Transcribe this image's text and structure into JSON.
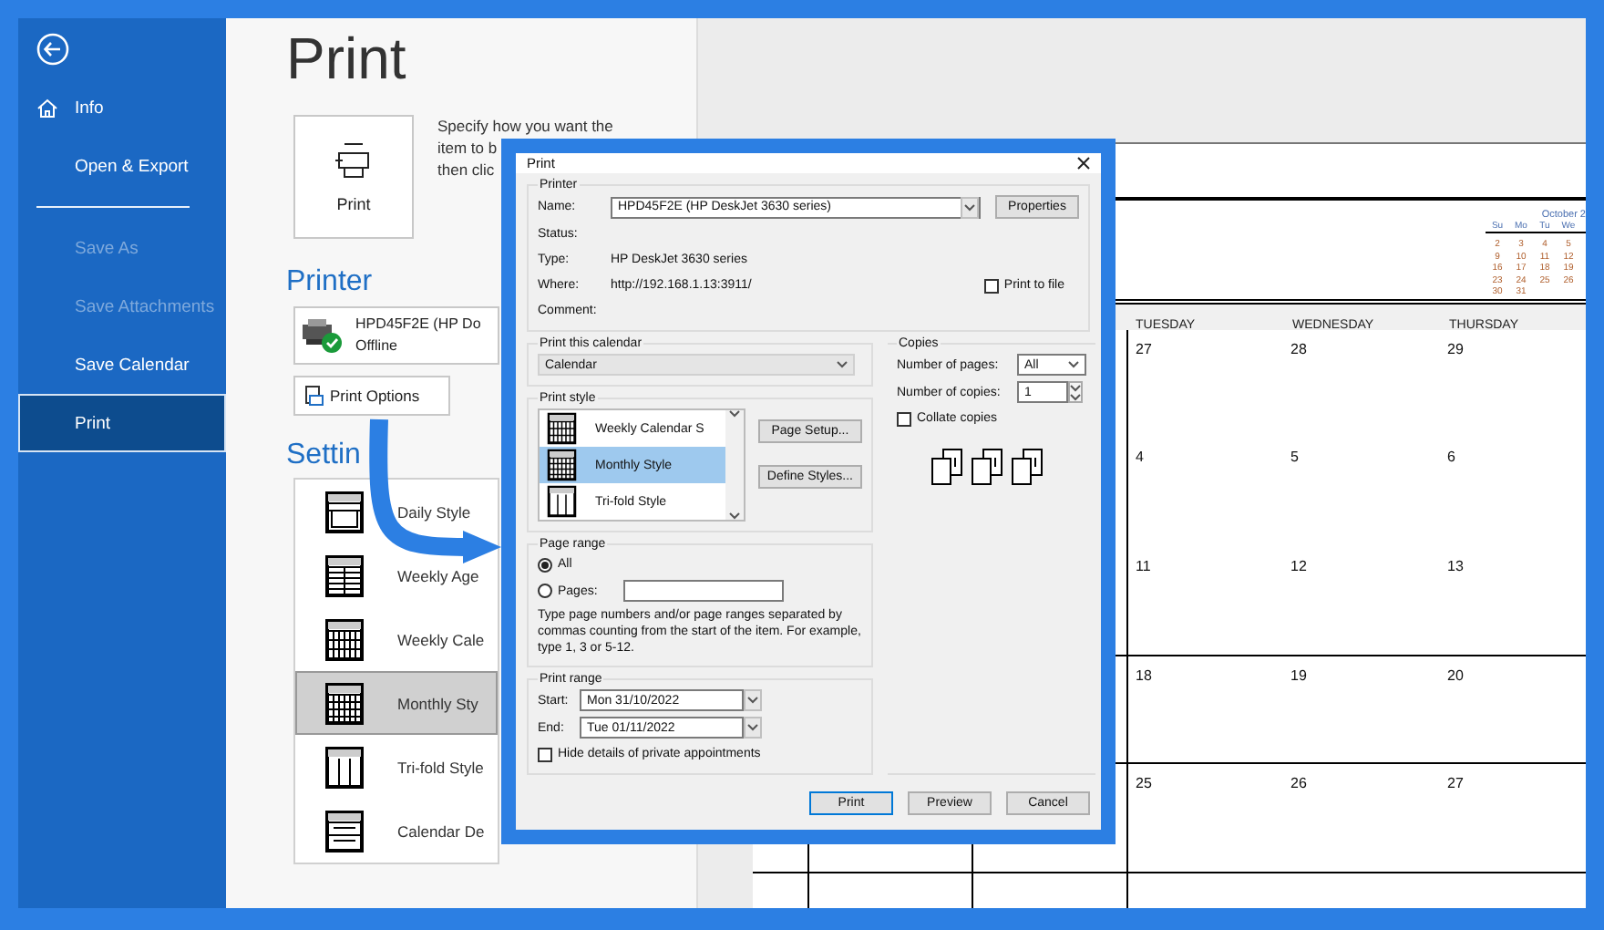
{
  "sidebar": {
    "items": [
      {
        "kind": "home",
        "label": "Info",
        "selected": false,
        "disabled": false
      },
      {
        "kind": "plain",
        "label": "Open & Export",
        "selected": false,
        "disabled": false
      },
      {
        "kind": "divider"
      },
      {
        "kind": "plain",
        "label": "Save As",
        "selected": false,
        "disabled": true
      },
      {
        "kind": "plain",
        "label": "Save Attachments",
        "selected": false,
        "disabled": true
      },
      {
        "kind": "plain",
        "label": "Save Calendar",
        "selected": false,
        "disabled": false
      },
      {
        "kind": "plain",
        "label": "Print",
        "selected": true,
        "disabled": false
      }
    ]
  },
  "page_title": "Print",
  "print_button": "Print",
  "description_lines": [
    "Specify how you want the",
    "item to b",
    "then clic"
  ],
  "printer": {
    "heading": "Printer",
    "name": "HPD45F2E (HP Do",
    "status": "Offline",
    "options_button": "Print Options"
  },
  "settings": {
    "heading": "Settin",
    "styles": [
      {
        "kind": "daily",
        "label": "Daily Style",
        "selected": false
      },
      {
        "kind": "agenda",
        "label": "Weekly Age",
        "selected": false
      },
      {
        "kind": "weekly",
        "label": "Weekly Cale",
        "selected": false
      },
      {
        "kind": "monthly",
        "label": "Monthly Sty",
        "selected": true
      },
      {
        "kind": "trifold",
        "label": "Tri-fold Style",
        "selected": false
      },
      {
        "kind": "details",
        "label": "Calendar De",
        "selected": false
      }
    ]
  },
  "preview": {
    "mini_calendar": {
      "title": "October 2",
      "weekdays": [
        "Su",
        "Mo",
        "Tu",
        "We"
      ],
      "weeks": [
        [
          "2",
          "3",
          "4",
          "5"
        ],
        [
          "9",
          "10",
          "11",
          "12"
        ],
        [
          "16",
          "17",
          "18",
          "19"
        ],
        [
          "23",
          "24",
          "25",
          "26"
        ],
        [
          "30",
          "31"
        ]
      ]
    },
    "day_headers": [
      "TUESDAY",
      "WEDNESDAY",
      "THURSDAY"
    ],
    "weeks": [
      [
        "27",
        "28",
        "29"
      ],
      [
        "4",
        "5",
        "6"
      ],
      [
        "11",
        "12",
        "13"
      ],
      [
        "18",
        "19",
        "20"
      ],
      [
        "25",
        "26",
        "27"
      ]
    ]
  },
  "dialog": {
    "title": "Print",
    "printer": {
      "legend": "Printer",
      "name_label": "Name:",
      "name_value": "HPD45F2E (HP DeskJet 3630 series)",
      "properties_button": "Properties",
      "status_label": "Status:",
      "type_label": "Type:",
      "type_value": "HP DeskJet 3630 series",
      "where_label": "Where:",
      "where_value": "http://192.168.1.13:3911/",
      "comment_label": "Comment:",
      "print_to_file": {
        "label": "Print to file",
        "checked": false
      }
    },
    "calendar_group": {
      "legend": "Print this calendar",
      "value": "Calendar"
    },
    "style_group": {
      "legend": "Print style",
      "items": [
        {
          "kind": "weekly",
          "label": "Weekly Calendar S",
          "selected": false
        },
        {
          "kind": "monthly",
          "label": "Monthly Style",
          "selected": true
        },
        {
          "kind": "trifold",
          "label": "Tri-fold Style",
          "selected": false
        }
      ],
      "buttons": [
        "Page Setup...",
        "Define Styles..."
      ]
    },
    "page_range": {
      "legend": "Page range",
      "options": [
        {
          "kind": "radio",
          "label": "All",
          "selected": true
        },
        {
          "kind": "radio_input",
          "label": "Pages:",
          "selected": false
        }
      ],
      "hint": "Type page numbers and/or page ranges separated by commas counting from the start of the item. For example, type 1, 3 or 5-12."
    },
    "print_range": {
      "legend": "Print range",
      "start_label": "Start:",
      "start_value": "Mon 31/10/2022",
      "end_label": "End:",
      "end_value": "Tue 01/11/2022",
      "hide_private": {
        "label": "Hide details of private appointments",
        "checked": false
      }
    },
    "copies": {
      "legend": "Copies",
      "pages_label": "Number of pages:",
      "pages_value": "All",
      "copies_label": "Number of copies:",
      "copies_value": "1",
      "collate": {
        "label": "Collate copies",
        "checked": false
      }
    },
    "buttons": [
      {
        "label": "Print",
        "default": true
      },
      {
        "label": "Preview",
        "default": false
      },
      {
        "label": "Cancel",
        "default": false
      }
    ]
  }
}
